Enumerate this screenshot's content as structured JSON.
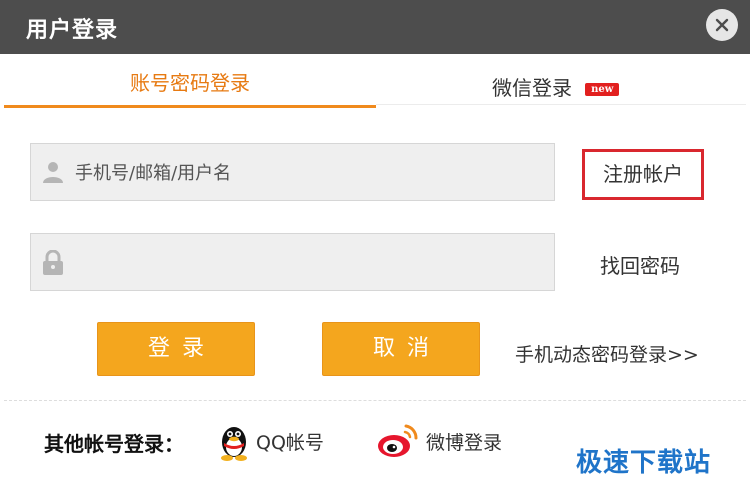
{
  "window": {
    "title": "用户登录",
    "close_icon": "close-icon"
  },
  "tabs": [
    {
      "label": "账号密码登录",
      "active": true
    },
    {
      "label": "微信登录",
      "badge": "new",
      "active": false
    }
  ],
  "form": {
    "username": {
      "placeholder": "手机号/邮箱/用户名",
      "value": "",
      "icon": "user-icon"
    },
    "password": {
      "placeholder": "",
      "value": "",
      "icon": "lock-icon"
    },
    "register_label": "注册帐户",
    "forgot_label": "找回密码",
    "login_label": "登录",
    "cancel_label": "取消",
    "sms_login_label": "手机动态密码登录>>"
  },
  "other_login": {
    "label": "其他帐号登录：",
    "options": [
      {
        "label": "QQ帐号",
        "icon": "qq-penguin-icon"
      },
      {
        "label": "微博登录",
        "icon": "weibo-icon"
      }
    ]
  },
  "watermark": "极速下载站",
  "colors": {
    "accent": "#f08a1d",
    "button": "#f4a61e",
    "titlebar": "#4d4d4d",
    "highlight_box": "#d9272e",
    "badge": "#e2201f"
  }
}
